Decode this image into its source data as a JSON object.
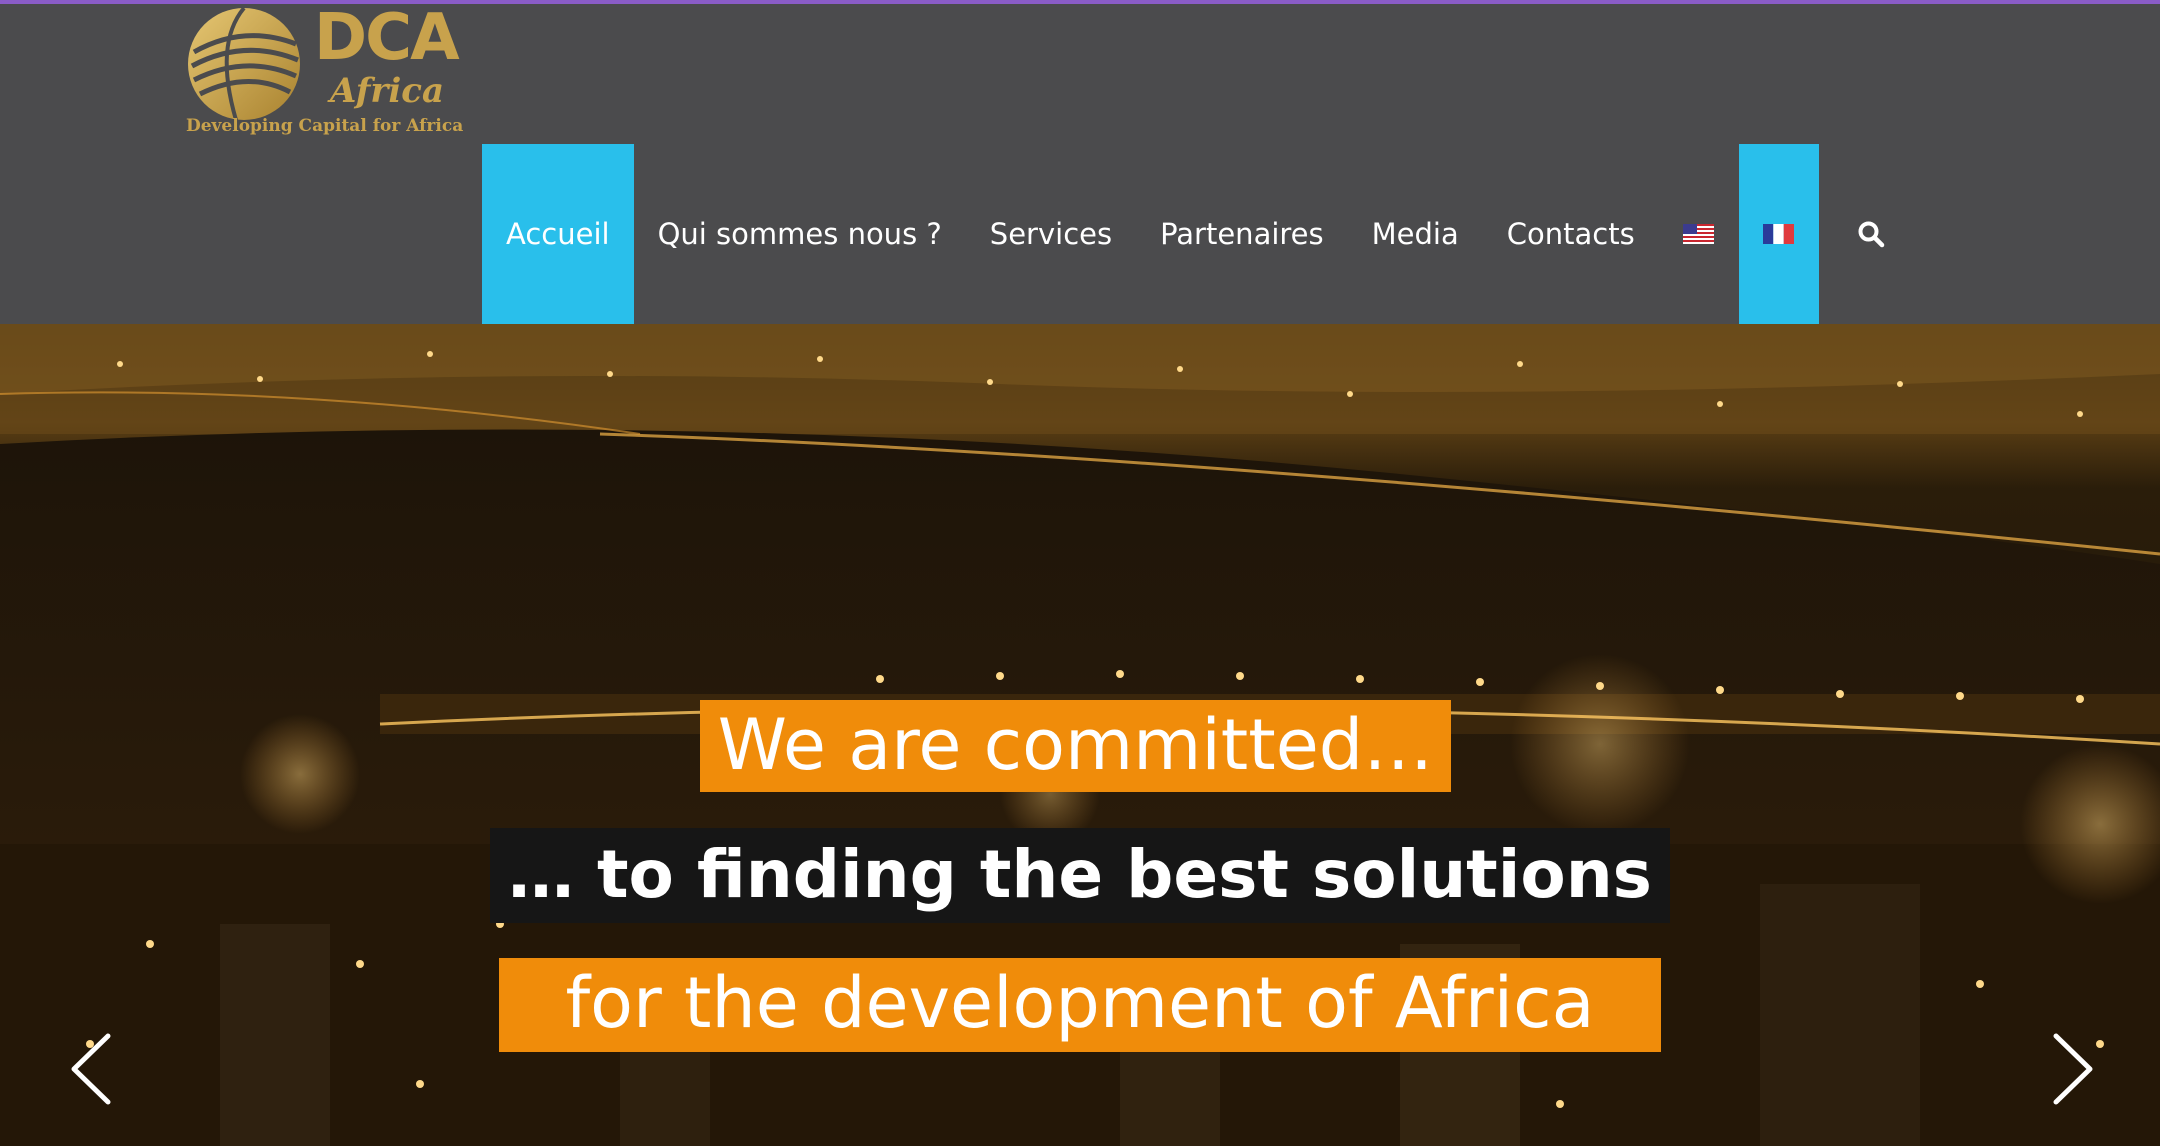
{
  "logo": {
    "title": "DCA",
    "subtitle": "Africa",
    "tagline": "Developing Capital for Africa"
  },
  "nav": {
    "items": [
      {
        "label": "Accueil",
        "active": true
      },
      {
        "label": "Qui sommes nous ?",
        "active": false
      },
      {
        "label": "Services",
        "active": false
      },
      {
        "label": "Partenaires",
        "active": false
      },
      {
        "label": "Media",
        "active": false
      },
      {
        "label": "Contacts",
        "active": false
      }
    ],
    "languages": [
      {
        "icon": "us-flag-icon",
        "active": false
      },
      {
        "icon": "fr-flag-icon",
        "active": true
      }
    ],
    "search_icon": "search-icon"
  },
  "hero": {
    "line1": "We are committed…",
    "line2": "… to finding the best solutions",
    "line3": "for the development of Africa",
    "prev_icon": "chevron-left-icon",
    "next_icon": "chevron-right-icon"
  },
  "colors": {
    "header_bg": "#4b4b4d",
    "accent_active": "#29bfeb",
    "logo_gold": "#c8a24c",
    "caption_orange": "#f08c0a",
    "caption_dark": "#161616"
  }
}
